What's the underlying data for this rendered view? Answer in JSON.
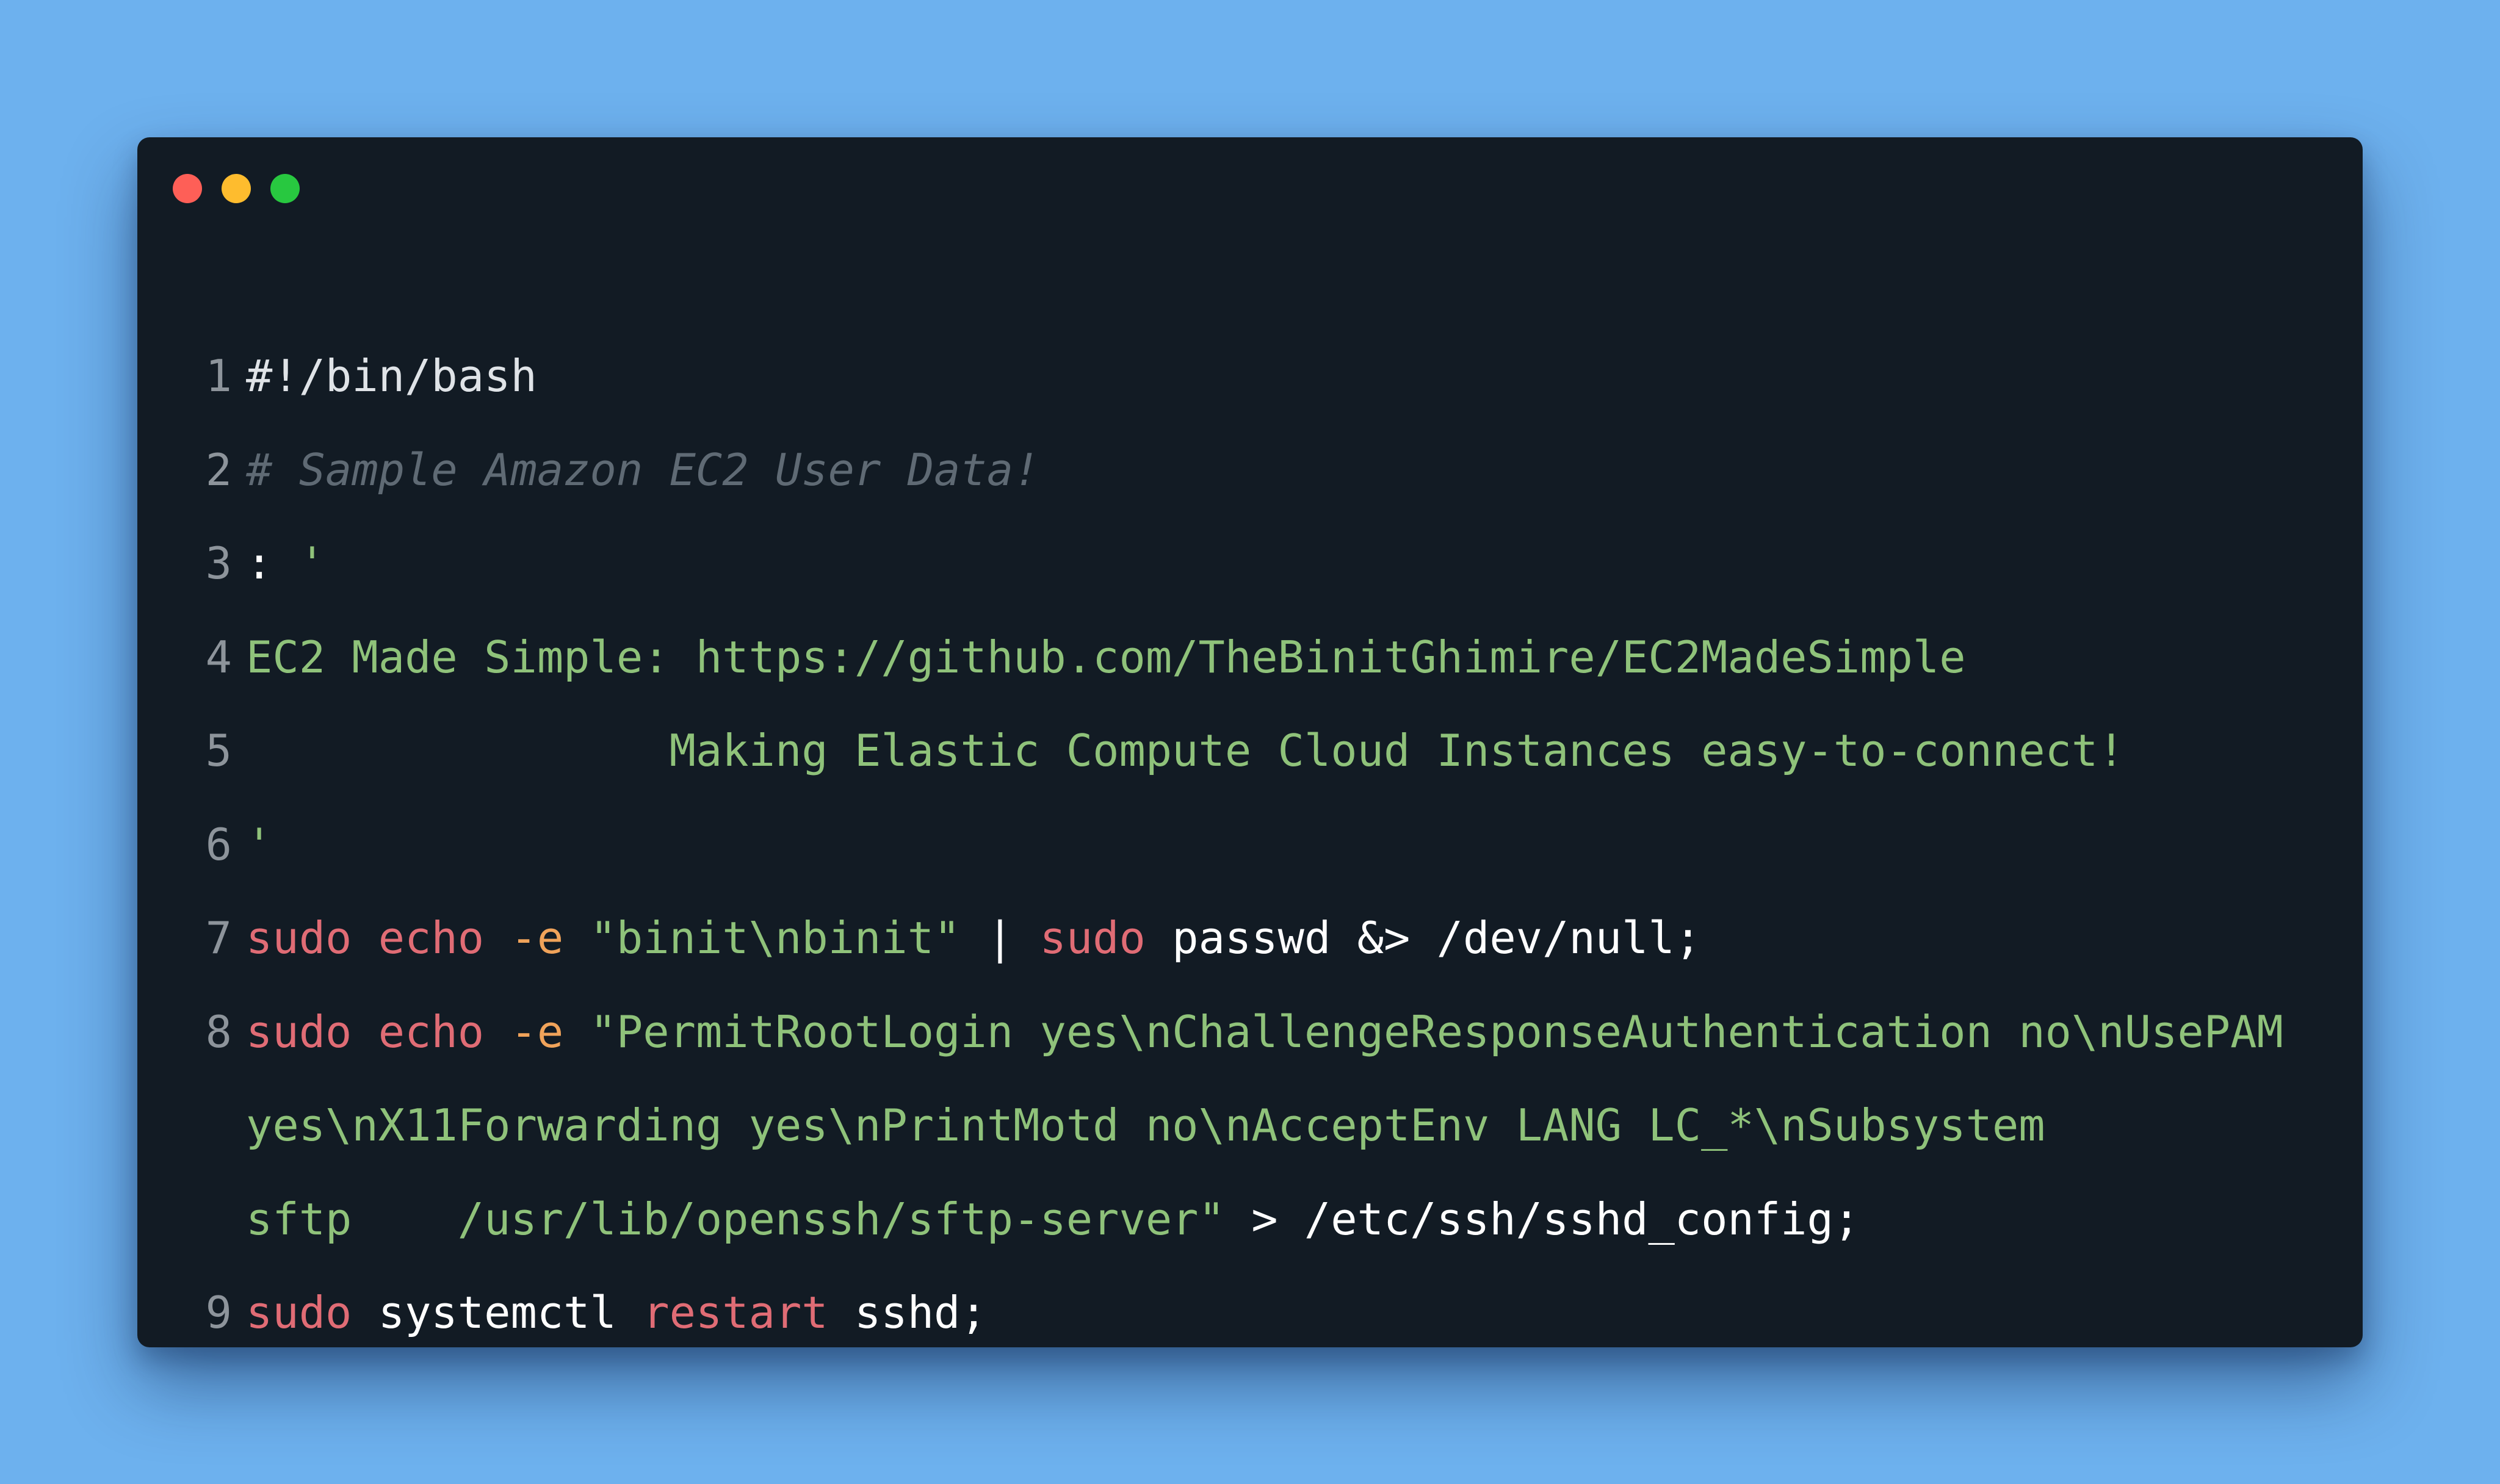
{
  "window": {
    "controls": [
      {
        "name": "close",
        "color": "#fe5f57"
      },
      {
        "name": "minimize",
        "color": "#febc2e"
      },
      {
        "name": "maximize",
        "color": "#28c840"
      }
    ]
  },
  "code": {
    "language": "bash",
    "lines": [
      {
        "number": "1",
        "tokens": [
          {
            "t": "#!/bin/bash",
            "c": "shebang"
          }
        ]
      },
      {
        "number": "2",
        "tokens": [
          {
            "t": "# Sample Amazon EC2 User Data!",
            "c": "comment"
          }
        ]
      },
      {
        "number": "3",
        "tokens": [
          {
            "t": ": ",
            "c": "plain"
          },
          {
            "t": "'",
            "c": "str"
          }
        ]
      },
      {
        "number": "4",
        "tokens": [
          {
            "t": "EC2 Made Simple: https://github.com/TheBinitGhimire/EC2MadeSimple",
            "c": "str"
          }
        ]
      },
      {
        "number": "5",
        "tokens": [
          {
            "t": "                Making Elastic Compute Cloud Instances easy-to-connect!",
            "c": "str"
          }
        ]
      },
      {
        "number": "6",
        "tokens": [
          {
            "t": "'",
            "c": "str"
          }
        ]
      },
      {
        "number": "7",
        "tokens": [
          {
            "t": "sudo",
            "c": "kw"
          },
          {
            "t": " ",
            "c": "plain"
          },
          {
            "t": "echo",
            "c": "kw"
          },
          {
            "t": " ",
            "c": "plain"
          },
          {
            "t": "-e",
            "c": "op"
          },
          {
            "t": " ",
            "c": "plain"
          },
          {
            "t": "\"binit\\nbinit\"",
            "c": "str"
          },
          {
            "t": " | ",
            "c": "plain"
          },
          {
            "t": "sudo",
            "c": "kw"
          },
          {
            "t": " passwd &> /dev/null;",
            "c": "plain"
          }
        ]
      },
      {
        "number": "8",
        "tokens": [
          {
            "t": "sudo",
            "c": "kw"
          },
          {
            "t": " ",
            "c": "plain"
          },
          {
            "t": "echo",
            "c": "kw"
          },
          {
            "t": " ",
            "c": "plain"
          },
          {
            "t": "-e",
            "c": "op"
          },
          {
            "t": " ",
            "c": "plain"
          },
          {
            "t": "\"PermitRootLogin yes\\nChallengeResponseAuthentication no\\nUsePAM",
            "c": "str"
          }
        ]
      },
      {
        "number": "",
        "tokens": [
          {
            "t": "yes\\nX11Forwarding yes\\nPrintMotd no\\nAcceptEnv LANG LC_*\\nSubsystem",
            "c": "str"
          }
        ]
      },
      {
        "number": "",
        "tokens": [
          {
            "t": "sftp    /usr/lib/openssh/sftp-server\"",
            "c": "str"
          },
          {
            "t": " > /etc/ssh/sshd_config;",
            "c": "plain"
          }
        ]
      },
      {
        "number": "9",
        "tokens": [
          {
            "t": "sudo",
            "c": "kw"
          },
          {
            "t": " systemctl ",
            "c": "plain"
          },
          {
            "t": "restart",
            "c": "kw"
          },
          {
            "t": " sshd;",
            "c": "plain"
          }
        ]
      }
    ]
  }
}
